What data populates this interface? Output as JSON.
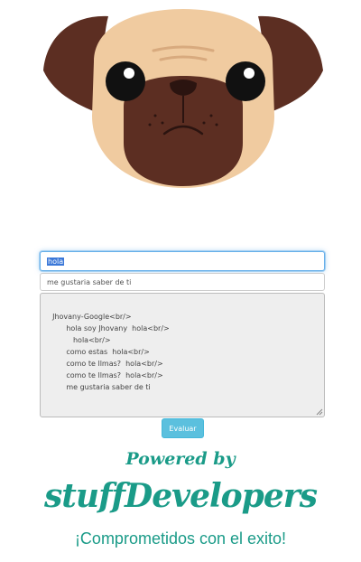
{
  "form": {
    "input_value": "hola",
    "message_value": "me gustaria saber de ti",
    "chat_log": "Jhovany-Google<br/>\n        hola soy Jhovany  hola<br/>\n           hola<br/>\n        como estas  hola<br/>\n        como te llmas?  hola<br/>\n        como te llmas?  hola<br/>\n        me gustaria saber de ti",
    "submit_label": "Evaluar"
  },
  "footer": {
    "powered_by": "Powered by",
    "brand": "stuffDevelopers",
    "tagline": "¡Comprometidos con el exito!"
  },
  "colors": {
    "brand": "#1a9b88",
    "button": "#5bc0de"
  }
}
